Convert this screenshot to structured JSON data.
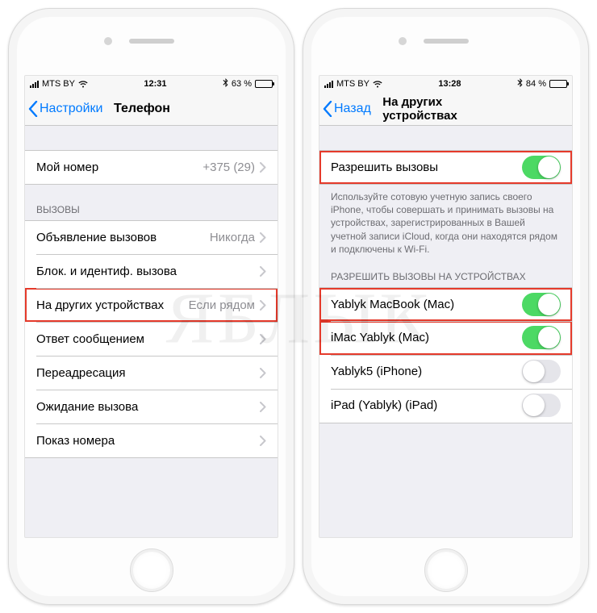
{
  "left": {
    "status": {
      "carrier": "MTS BY",
      "time": "12:31",
      "battery_text": "63 %",
      "battery_pct": 63,
      "battery_color": "#ffcc00"
    },
    "nav": {
      "back": "Настройки",
      "title": "Телефон"
    },
    "my_number": {
      "label": "Мой номер",
      "value": "+375 (29)"
    },
    "section_calls": "ВЫЗОВЫ",
    "rows": {
      "announce": {
        "label": "Объявление вызовов",
        "value": "Никогда"
      },
      "block": {
        "label": "Блок. и идентиф. вызова"
      },
      "other": {
        "label": "На других устройствах",
        "value": "Если рядом"
      },
      "reply": {
        "label": "Ответ сообщением"
      },
      "forwarding": {
        "label": "Переадресация"
      },
      "waiting": {
        "label": "Ожидание вызова"
      },
      "caller_id": {
        "label": "Показ номера"
      }
    }
  },
  "right": {
    "status": {
      "carrier": "MTS BY",
      "time": "13:28",
      "battery_text": "84 %",
      "battery_pct": 84
    },
    "nav": {
      "back": "Назад",
      "title": "На других устройствах"
    },
    "allow": {
      "label": "Разрешить вызовы",
      "on": true
    },
    "footer": "Используйте сотовую учетную запись своего iPhone, чтобы совершать и принимать вызовы на устройствах, зарегистрированных в Вашей учетной записи iCloud, когда они находятся рядом и подключены к Wi-Fi.",
    "section_devices": "РАЗРЕШИТЬ ВЫЗОВЫ НА УСТРОЙСТВАХ",
    "devices": [
      {
        "label": "Yablyk MacBook (Mac)",
        "on": true,
        "hl": true
      },
      {
        "label": "iMac Yablyk (Mac)",
        "on": true,
        "hl": true
      },
      {
        "label": "Yablyk5 (iPhone)",
        "on": false
      },
      {
        "label": "iPad (Yablyk) (iPad)",
        "on": false
      }
    ]
  },
  "watermark": "ЯБЛЫК"
}
